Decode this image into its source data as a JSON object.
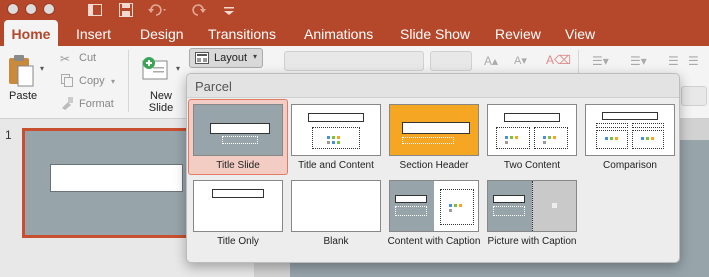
{
  "quick_access": {
    "icons": [
      "close-window",
      "minimize-window",
      "zoom-window",
      "sidebar-icon",
      "save-icon",
      "undo-icon",
      "redo-icon",
      "customize-icon"
    ]
  },
  "ribbon_tabs": [
    "Home",
    "Insert",
    "Design",
    "Transitions",
    "Animations",
    "Slide Show",
    "Review",
    "View"
  ],
  "clipboard": {
    "paste_label": "Paste",
    "cut_label": "Cut",
    "copy_label": "Copy",
    "format_label": "Format"
  },
  "slides": {
    "new_slide_line1": "New",
    "new_slide_line2": "Slide",
    "layout_label": "Layout"
  },
  "thumbnail": {
    "number": "1"
  },
  "layout_menu": {
    "theme_name": "Parcel",
    "selected": "Title Slide",
    "layouts": [
      "Title Slide",
      "Title and Content",
      "Section Header",
      "Two Content",
      "Comparison",
      "Title Only",
      "Blank",
      "Content with Caption",
      "Picture with Caption"
    ]
  },
  "colors": {
    "ribbon_brand": "#b5472b",
    "section_header_accent": "#f5a623",
    "slide_background": "#97a5ab",
    "selection_border": "#e07b65"
  }
}
